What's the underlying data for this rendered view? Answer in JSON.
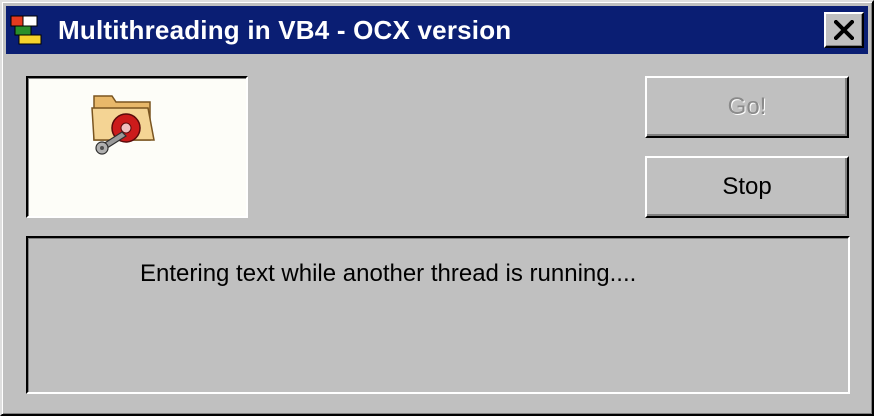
{
  "window": {
    "title": "Multithreading in VB4 - OCX version",
    "app_icon": "vb-app-icon",
    "close_icon": "close-icon"
  },
  "picture": {
    "icon": "folder-disc-icon"
  },
  "buttons": {
    "go_label": "Go!",
    "stop_label": "Stop"
  },
  "text_box": {
    "value": "Entering text while another thread is running...."
  },
  "colors": {
    "titlebar": "#0a1e73",
    "face": "#c0c0c0",
    "disabled_text": "#8a8a8a"
  }
}
